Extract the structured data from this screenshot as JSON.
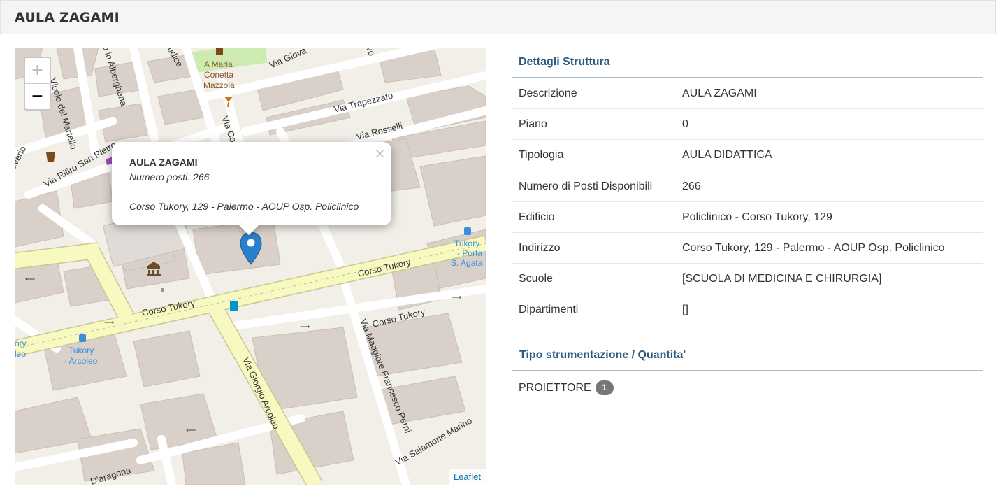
{
  "header": {
    "title": "AULA ZAGAMI"
  },
  "map": {
    "zoom_in": "+",
    "zoom_out": "−",
    "attribution": "Leaflet",
    "popup": {
      "close": "×",
      "title": "AULA ZAGAMI",
      "seats": "Numero posti: 266",
      "address": "Corso Tukory, 129 - Palermo - AOUP Osp. Policlinico"
    },
    "labels": {
      "corso_tukory_1": "Corso Tukory",
      "corso_tukory_2": "Corso Tukory",
      "corso_tukory_3": "Corso Tukory",
      "via_trapezzato": "Via Trapezzato",
      "via_rosselli": "Via Rosselli",
      "via_ritiro": "Via Ritiro San Pietro",
      "vicolo_martello": "Vicolo del Martello",
      "albergheria": "o in Albergheria",
      "via_arcoleo": "Via Giorgio Arcoleo",
      "via_perni": "Via Maggiore Francesco Perni",
      "via_marino": "Via Salamone Marino",
      "aragona": "D'aragona",
      "via_giova": "Via Giova",
      "via_co": "Via Co",
      "udice": "udice",
      "vo": "vo",
      "averio": "averio",
      "maria_1": "A Maria",
      "maria_2": "Conetta",
      "maria_3": "Mazzola",
      "stop_porta_1": "Tukory",
      "stop_porta_2": "- Porta",
      "stop_porta_3": "S. Agata",
      "stop_arcoleo_1": "Tukory",
      "stop_arcoleo_2": "- Arcoleo",
      "stop_left_1": "ory",
      "stop_left_2": "leo"
    }
  },
  "details": {
    "section_title": "Dettagli Struttura",
    "rows": [
      {
        "label": "Descrizione",
        "value": "AULA ZAGAMI"
      },
      {
        "label": "Piano",
        "value": "0"
      },
      {
        "label": "Tipologia",
        "value": "AULA DIDATTICA"
      },
      {
        "label": "Numero di Posti Disponibili",
        "value": "266"
      },
      {
        "label": "Edificio",
        "value": "Policlinico - Corso Tukory, 129"
      },
      {
        "label": "Indirizzo",
        "value": "Corso Tukory, 129 - Palermo - AOUP Osp. Policlinico"
      },
      {
        "label": "Scuole",
        "value": "[SCUOLA DI MEDICINA E CHIRURGIA]"
      },
      {
        "label": "Dipartimenti",
        "value": "[]"
      }
    ]
  },
  "equipment": {
    "section_title": "Tipo strumentazione / Quantita'",
    "items": [
      {
        "name": "PROIETTORE",
        "count": "1"
      }
    ]
  },
  "colors": {
    "section_title": "#2b5a80",
    "badge": "#777777",
    "main_road": "#f7f9c0",
    "building": "#d9d0c9",
    "pin": "#2a81cb"
  }
}
